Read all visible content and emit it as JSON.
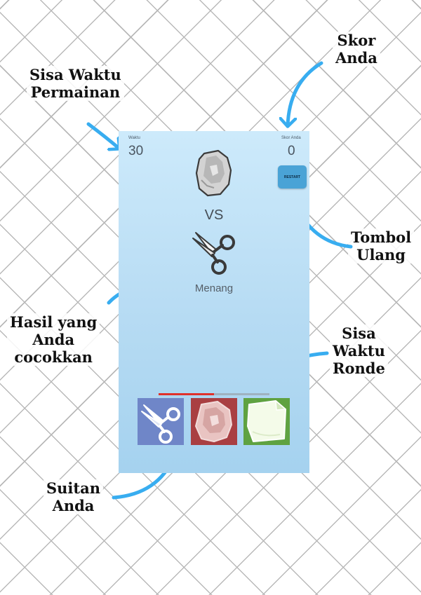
{
  "annotations": {
    "game_time": "Sisa Waktu\nPermainan",
    "score": "Skor\nAnda",
    "restart": "Tombol\nUlang",
    "result": "Hasil yang\nAnda\ncocokkan",
    "round_time": "Sisa\nWaktu\nRonde",
    "choices": "Suitan\nAnda"
  },
  "game": {
    "time_label": "Waktu",
    "time_value": "30",
    "score_label": "Skor Anda",
    "score_value": "0",
    "restart_label": "RESTART",
    "opponent_choice_icon": "rock-icon",
    "vs_label": "VS",
    "player_choice_icon": "scissors-icon",
    "result_text": "Menang",
    "round_time_remaining": 0.5,
    "round_bar_color": "#e0312b"
  },
  "choices": [
    {
      "icon": "scissors-icon",
      "color": "#6f86c8"
    },
    {
      "icon": "rock-icon",
      "color": "#a93f42"
    },
    {
      "icon": "paper-icon",
      "color": "#5fa241"
    }
  ]
}
